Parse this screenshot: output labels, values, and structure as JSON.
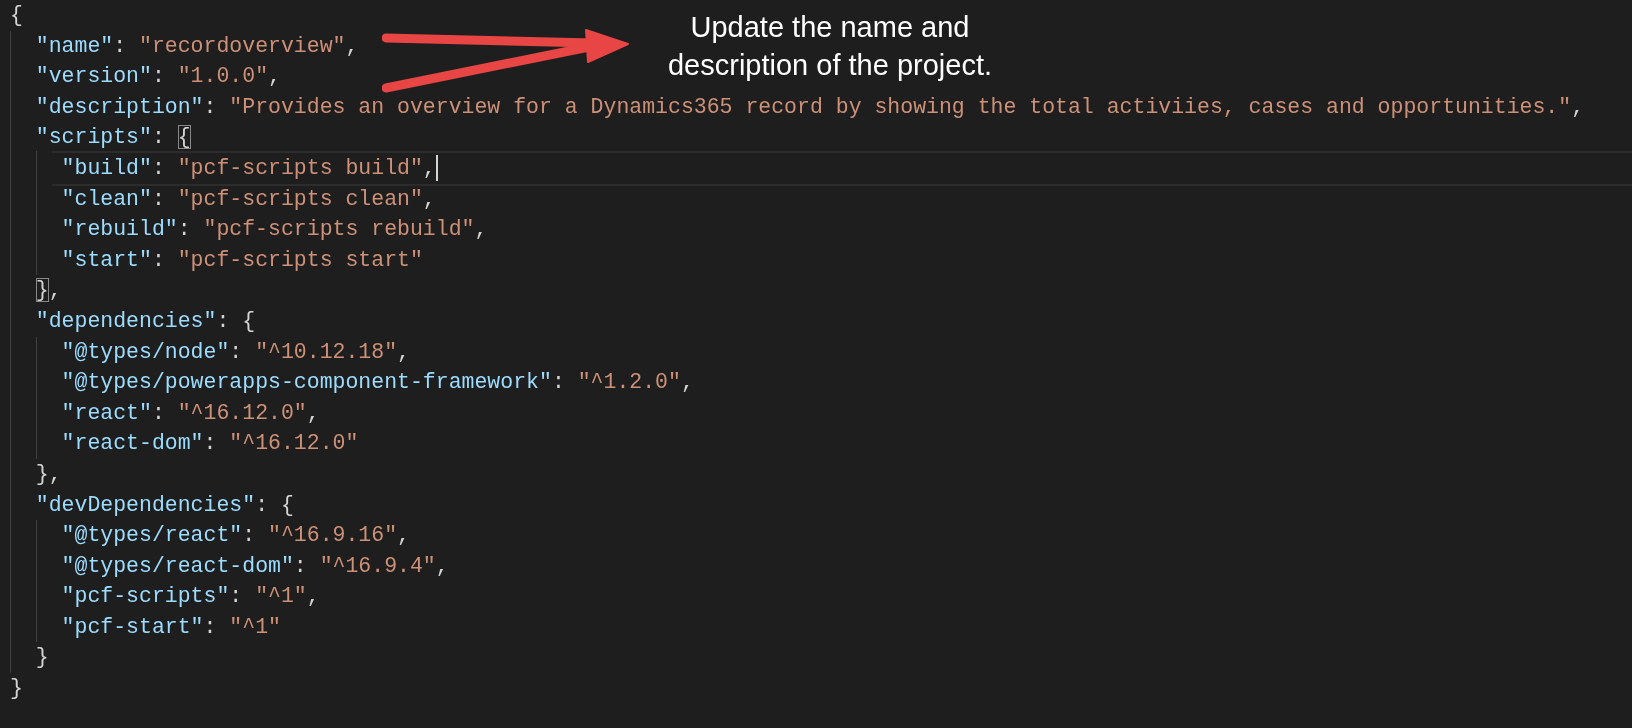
{
  "editor": {
    "lines": [
      {
        "current": false,
        "tokens": [
          {
            "kind": "brace",
            "text": "{",
            "matched": false
          }
        ],
        "children": [
          {
            "current": false,
            "tokens": [
              {
                "kind": "key",
                "text": "\"name\""
              },
              {
                "kind": "colon",
                "text": ":"
              },
              {
                "kind": "string",
                "text": "\"recordoverview\""
              },
              {
                "kind": "punct",
                "text": ","
              }
            ]
          },
          {
            "current": false,
            "tokens": [
              {
                "kind": "key",
                "text": "\"version\""
              },
              {
                "kind": "colon",
                "text": ":"
              },
              {
                "kind": "string",
                "text": "\"1.0.0\""
              },
              {
                "kind": "punct",
                "text": ","
              }
            ]
          },
          {
            "current": false,
            "tokens": [
              {
                "kind": "key",
                "text": "\"description\""
              },
              {
                "kind": "colon",
                "text": ":"
              },
              {
                "kind": "string",
                "text": "\"Provides an overview for a Dynamics365 record by showing the total activiies, cases and opportunities.\""
              },
              {
                "kind": "punct",
                "text": ","
              }
            ]
          },
          {
            "current": false,
            "tokens": [
              {
                "kind": "key",
                "text": "\"scripts\""
              },
              {
                "kind": "colon",
                "text": ":"
              },
              {
                "kind": "brace",
                "text": "{",
                "matched": true
              }
            ],
            "children": [
              {
                "current": true,
                "tokens": [
                  {
                    "kind": "key",
                    "text": "\"build\""
                  },
                  {
                    "kind": "colon",
                    "text": ":"
                  },
                  {
                    "kind": "string",
                    "text": "\"pcf-scripts build\""
                  },
                  {
                    "kind": "punct",
                    "text": ","
                  }
                ]
              },
              {
                "current": false,
                "tokens": [
                  {
                    "kind": "key",
                    "text": "\"clean\""
                  },
                  {
                    "kind": "colon",
                    "text": ":"
                  },
                  {
                    "kind": "string",
                    "text": "\"pcf-scripts clean\""
                  },
                  {
                    "kind": "punct",
                    "text": ","
                  }
                ]
              },
              {
                "current": false,
                "tokens": [
                  {
                    "kind": "key",
                    "text": "\"rebuild\""
                  },
                  {
                    "kind": "colon",
                    "text": ":"
                  },
                  {
                    "kind": "string",
                    "text": "\"pcf-scripts rebuild\""
                  },
                  {
                    "kind": "punct",
                    "text": ","
                  }
                ]
              },
              {
                "current": false,
                "tokens": [
                  {
                    "kind": "key",
                    "text": "\"start\""
                  },
                  {
                    "kind": "colon",
                    "text": ":"
                  },
                  {
                    "kind": "string",
                    "text": "\"pcf-scripts start\""
                  }
                ]
              }
            ]
          },
          {
            "current": false,
            "tokens": [
              {
                "kind": "brace",
                "text": "}",
                "matched": true
              },
              {
                "kind": "punct",
                "text": ","
              }
            ]
          },
          {
            "current": false,
            "tokens": [
              {
                "kind": "key",
                "text": "\"dependencies\""
              },
              {
                "kind": "colon",
                "text": ":"
              },
              {
                "kind": "brace",
                "text": "{",
                "matched": false
              }
            ],
            "children": [
              {
                "current": false,
                "tokens": [
                  {
                    "kind": "key",
                    "text": "\"@types/node\""
                  },
                  {
                    "kind": "colon",
                    "text": ":"
                  },
                  {
                    "kind": "string",
                    "text": "\"^10.12.18\""
                  },
                  {
                    "kind": "punct",
                    "text": ","
                  }
                ]
              },
              {
                "current": false,
                "tokens": [
                  {
                    "kind": "key",
                    "text": "\"@types/powerapps-component-framework\""
                  },
                  {
                    "kind": "colon",
                    "text": ":"
                  },
                  {
                    "kind": "string",
                    "text": "\"^1.2.0\""
                  },
                  {
                    "kind": "punct",
                    "text": ","
                  }
                ]
              },
              {
                "current": false,
                "tokens": [
                  {
                    "kind": "key",
                    "text": "\"react\""
                  },
                  {
                    "kind": "colon",
                    "text": ":"
                  },
                  {
                    "kind": "string",
                    "text": "\"^16.12.0\""
                  },
                  {
                    "kind": "punct",
                    "text": ","
                  }
                ]
              },
              {
                "current": false,
                "tokens": [
                  {
                    "kind": "key",
                    "text": "\"react-dom\""
                  },
                  {
                    "kind": "colon",
                    "text": ":"
                  },
                  {
                    "kind": "string",
                    "text": "\"^16.12.0\""
                  }
                ]
              }
            ]
          },
          {
            "current": false,
            "tokens": [
              {
                "kind": "brace",
                "text": "}",
                "matched": false
              },
              {
                "kind": "punct",
                "text": ","
              }
            ]
          },
          {
            "current": false,
            "tokens": [
              {
                "kind": "key",
                "text": "\"devDependencies\""
              },
              {
                "kind": "colon",
                "text": ":"
              },
              {
                "kind": "brace",
                "text": "{",
                "matched": false
              }
            ],
            "children": [
              {
                "current": false,
                "tokens": [
                  {
                    "kind": "key",
                    "text": "\"@types/react\""
                  },
                  {
                    "kind": "colon",
                    "text": ":"
                  },
                  {
                    "kind": "string",
                    "text": "\"^16.9.16\""
                  },
                  {
                    "kind": "punct",
                    "text": ","
                  }
                ]
              },
              {
                "current": false,
                "tokens": [
                  {
                    "kind": "key",
                    "text": "\"@types/react-dom\""
                  },
                  {
                    "kind": "colon",
                    "text": ":"
                  },
                  {
                    "kind": "string",
                    "text": "\"^16.9.4\""
                  },
                  {
                    "kind": "punct",
                    "text": ","
                  }
                ]
              },
              {
                "current": false,
                "tokens": [
                  {
                    "kind": "key",
                    "text": "\"pcf-scripts\""
                  },
                  {
                    "kind": "colon",
                    "text": ":"
                  },
                  {
                    "kind": "string",
                    "text": "\"^1\""
                  },
                  {
                    "kind": "punct",
                    "text": ","
                  }
                ]
              },
              {
                "current": false,
                "tokens": [
                  {
                    "kind": "key",
                    "text": "\"pcf-start\""
                  },
                  {
                    "kind": "colon",
                    "text": ":"
                  },
                  {
                    "kind": "string",
                    "text": "\"^1\""
                  }
                ]
              }
            ]
          },
          {
            "current": false,
            "tokens": [
              {
                "kind": "brace",
                "text": "}",
                "matched": false
              }
            ]
          }
        ]
      },
      {
        "current": false,
        "tokens": [
          {
            "kind": "brace",
            "text": "}",
            "matched": false
          }
        ]
      }
    ]
  },
  "annotation": {
    "lines": [
      "Update the name and",
      "description of the project."
    ]
  }
}
